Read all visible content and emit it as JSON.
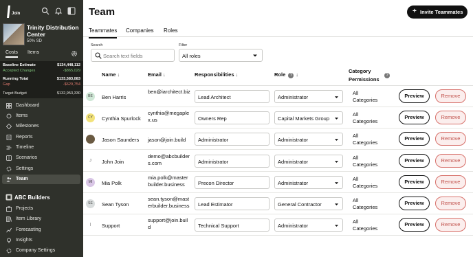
{
  "sidebar": {
    "logo_text": "Join",
    "project": {
      "name": "Trinity Distribution Center",
      "stage": "50% SD"
    },
    "tabs": [
      "Costs",
      "Items"
    ],
    "financials": [
      {
        "label": "Baseline Estimate",
        "value": "$134,448,112",
        "style": "bold"
      },
      {
        "label": "Accepted Changes",
        "value": "-$865,029",
        "style": "green"
      },
      {
        "label": "Running Total",
        "value": "$133,583,083",
        "style": "bold"
      },
      {
        "label": "Gap",
        "value": "-$629,754",
        "style": "red"
      },
      {
        "label": "Target Budget",
        "value": "$132,953,330",
        "style": "normal"
      }
    ],
    "project_nav": [
      "Dashboard",
      "Items",
      "Milestones",
      "Reports",
      "Timeline",
      "Scenarios",
      "Settings",
      "Team"
    ],
    "active_nav": "Team",
    "company": "ABC Builders",
    "company_nav": [
      "Projects",
      "Item Library",
      "Forecasting",
      "Insights",
      "Company Settings"
    ]
  },
  "main": {
    "title": "Team",
    "invite_label": "Invite Teammates",
    "tabs": [
      "Teammates",
      "Companies",
      "Roles"
    ],
    "search_label": "Search",
    "search_placeholder": "Search text fields",
    "filter_label": "Filter",
    "filter_value": "All roles",
    "columns": {
      "name": "Name",
      "email": "Email",
      "responsibilities": "Responsibilities",
      "role": "Role",
      "category": "Category Permissions"
    },
    "rows": [
      {
        "initials": "BE",
        "avatar_color": "#cfe7d6",
        "name": "Ben Harris",
        "email": "ben@iarchitect.biz",
        "responsibility": "Lead Architect",
        "role": "Administrator",
        "category": "All Categories"
      },
      {
        "initials": "CY",
        "avatar_color": "#f2e27a",
        "name": "Cynthia Spurlock",
        "email": "cynthia@megaplex.us",
        "responsibility": "Owners Rep",
        "role": "Capital Markets Group",
        "category": "All Categories"
      },
      {
        "initials": "",
        "avatar_color": "#6a5a42",
        "name": "Jason Saunders",
        "email": "jason@join.build",
        "responsibility": "Administrator",
        "role": "Administrator",
        "category": "All Categories"
      },
      {
        "initials": "J",
        "avatar_color": "#ffffff",
        "name": "John Join",
        "email": "demo@abcbuilders.com",
        "responsibility": "Administrator",
        "role": "Administrator",
        "category": "All Categories"
      },
      {
        "initials": "MI",
        "avatar_color": "#d9c6e6",
        "name": "Mia Polk",
        "email": "mia.polk@masterbuilder.business",
        "responsibility": "Precon Director",
        "role": "Administrator",
        "category": "All Categories"
      },
      {
        "initials": "SE",
        "avatar_color": "#d8dcdc",
        "name": "Sean Tyson",
        "email": "sean.tyson@masterbuilder.business",
        "responsibility": "Lead Estimator",
        "role": "General Contractor",
        "category": "All Categories"
      },
      {
        "initials": "|",
        "avatar_color": "#ffffff",
        "name": "Support",
        "email": "support@join.build",
        "responsibility": "Technical Support",
        "role": "Administrator",
        "category": "All Categories"
      }
    ],
    "preview_label": "Preview",
    "remove_label": "Remove"
  }
}
